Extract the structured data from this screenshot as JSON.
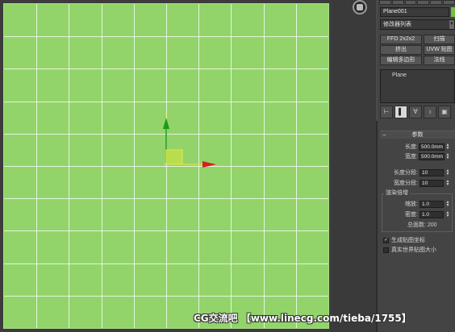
{
  "viewport": {
    "grid_divisions": 10,
    "plane_color": "#92d46a",
    "grid_color": "#ffffff",
    "gizmo": {
      "x_axis_color": "#d42020",
      "y_axis_color": "#1a9a1a",
      "center_color": "#e8e830"
    }
  },
  "command_panel": {
    "object_name": "Plane001",
    "object_color": "#6ec040",
    "modifier_list": "修改器列表",
    "modifier_buttons": [
      {
        "label": "FFD 2x2x2"
      },
      {
        "label": "扫描"
      },
      {
        "label": "挤出"
      },
      {
        "label": "UVW 贴图"
      },
      {
        "label": "编辑多边形"
      },
      {
        "label": "法线"
      }
    ],
    "stack": {
      "item": "Plane"
    },
    "stack_tools": [
      "pin-stack-icon",
      "show-end-result-icon",
      "make-unique-icon",
      "remove-modifier-icon",
      "configure-modifier-sets-icon"
    ],
    "parameters": {
      "title": "参数",
      "length_label": "长度:",
      "length_value": "500.0mm",
      "width_label": "宽度:",
      "width_value": "500.0mm",
      "length_segs_label": "长度分段:",
      "length_segs_value": "10",
      "width_segs_label": "宽度分段:",
      "width_segs_value": "10",
      "render_group_title": "渲染倍增",
      "scale_label": "缩放:",
      "scale_value": "1.0",
      "density_label": "密度:",
      "density_value": "1.0",
      "total_faces": "总面数: 200",
      "gen_map_coords": {
        "label": "生成贴图坐标",
        "checked": true
      },
      "real_world_map": {
        "label": "真实世界贴图大小",
        "checked": false
      }
    }
  },
  "watermark": "CG交流吧 【www.linecg.com/tieba/1755】"
}
